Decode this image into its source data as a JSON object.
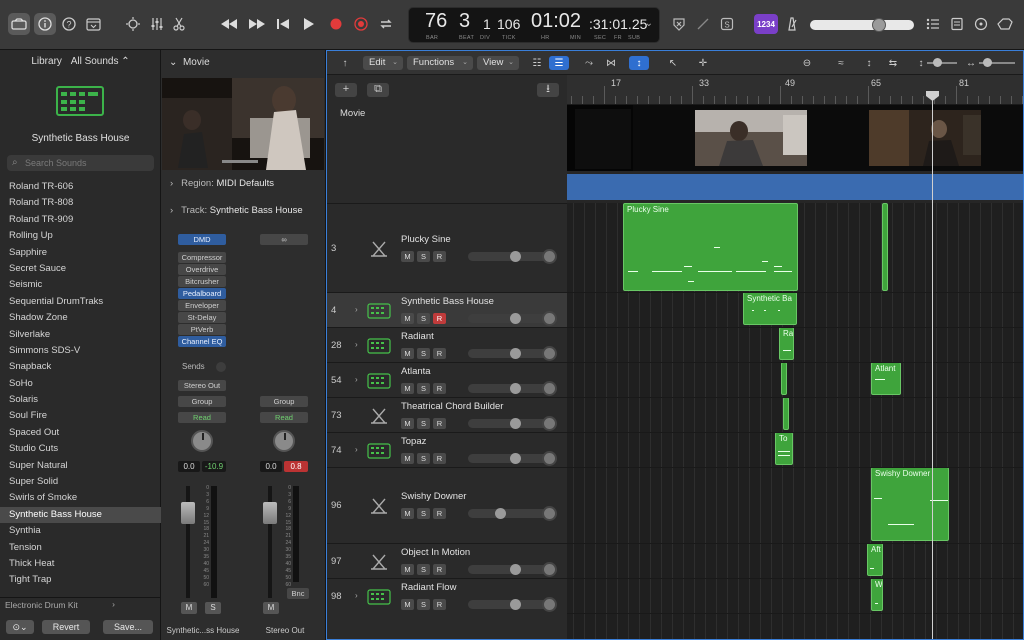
{
  "top": {
    "lcd": {
      "bar": "76",
      "beat": "3",
      "div": "1",
      "tick": "106",
      "bar_cap": "BAR",
      "beat_cap": "BEAT",
      "div_cap": "DIV",
      "tick_cap": "TICK",
      "time_main": "01:02",
      "time_sub": ":31:01.25",
      "hr_cap": "HR",
      "min_cap": "MIN",
      "sec_cap": "SEC",
      "fr_cap": "FR",
      "sub_cap": "SUB"
    },
    "count_in": "1234"
  },
  "library": {
    "title": "Library",
    "category": "All Sounds ⌃",
    "preset": "Synthetic Bass House",
    "search_placeholder": "Search Sounds",
    "items": [
      "Roland TR-606",
      "Roland TR-808",
      "Roland TR-909",
      "Rolling Up",
      "Sapphire",
      "Secret Sauce",
      "Seismic",
      "Sequential DrumTraks",
      "Shadow Zone",
      "Silverlake",
      "Simmons SDS-V",
      "Snapback",
      "SoHo",
      "Solaris",
      "Soul Fire",
      "Spaced Out",
      "Studio Cuts",
      "Super Natural",
      "Super Solid",
      "Swirls of Smoke",
      "Synthetic Bass House",
      "Synthia",
      "Tension",
      "Thick Heat",
      "Tight Trap"
    ],
    "selected_index": 20,
    "footer": "Electronic Drum Kit",
    "revert": "Revert",
    "save": "Save..."
  },
  "inspector": {
    "movie_title": "Movie",
    "region_label": "Region:",
    "region_value": "MIDI Defaults",
    "track_label": "Track:",
    "track_value": "Synthetic Bass House",
    "strip1": {
      "setting": "DMD",
      "plugins": [
        "Compressor",
        "Overdrive",
        "Bitcrusher",
        "Pedalboard",
        "Enveloper",
        "St-Delay",
        "PtVerb",
        "Channel EQ"
      ],
      "plugins_blue": [
        3,
        7
      ],
      "sends": "Sends",
      "output": "Stereo Out",
      "group": "Group",
      "automation": "Read",
      "vol": "0.0",
      "peak": "-10.9",
      "m": "M",
      "s": "S",
      "name": "Synthetic...ss House"
    },
    "strip2": {
      "group": "Group",
      "automation": "Read",
      "vol": "0.0",
      "peak": "0.8",
      "bnc": "Bnc",
      "m": "M",
      "name": "Stereo Out"
    },
    "scale": [
      "0",
      "3",
      "6",
      "9",
      "12",
      "15",
      "18",
      "21",
      "24",
      "30",
      "35",
      "40",
      "45",
      "50",
      "60"
    ]
  },
  "tracks_area": {
    "menus": {
      "edit": "Edit",
      "functions": "Functions",
      "view": "View"
    },
    "ruler": [
      "17",
      "33",
      "49",
      "65",
      "81"
    ],
    "movie_track": "Movie",
    "tracks": [
      {
        "num": "3",
        "name": "Plucky Sine",
        "rec": false
      },
      {
        "num": "4",
        "name": "Synthetic Bass House",
        "rec": true
      },
      {
        "num": "28",
        "name": "Radiant",
        "rec": false
      },
      {
        "num": "54",
        "name": "Atlanta",
        "rec": false
      },
      {
        "num": "73",
        "name": "Theatrical Chord Builder",
        "rec": false
      },
      {
        "num": "74",
        "name": "Topaz",
        "rec": false
      },
      {
        "num": "96",
        "name": "Swishy Downer",
        "rec": false
      },
      {
        "num": "97",
        "name": "Object In Motion",
        "rec": false
      },
      {
        "num": "98",
        "name": "Radiant Flow",
        "rec": false
      }
    ],
    "btn_m": "M",
    "btn_s": "S",
    "btn_r": "R",
    "regions": {
      "r1": "Plucky Sine",
      "r2": "Synthetic Ba",
      "r3": "Ra",
      "r4": "Atlant",
      "r5": "To",
      "r6": "Swishy Downer",
      "r7": "Aft",
      "r8": "W"
    }
  },
  "colors": {
    "accent": "#2f6fd0",
    "region_green": "#3fa43c",
    "record_red": "#c03b3b",
    "count_in_purple": "#7a3fc8"
  }
}
